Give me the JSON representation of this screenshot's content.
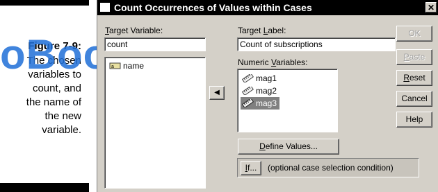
{
  "caption": {
    "figure_label": "Figure 7-9:",
    "lines": [
      "The chosen",
      "variables to",
      "count, and",
      "the name of",
      "the new",
      "variable."
    ]
  },
  "watermark": "oBooks",
  "dialog": {
    "title": "Count Occurrences of Values within Cases",
    "close_glyph": "✕",
    "target_variable": {
      "label_u": "T",
      "label_rest": "arget Variable:",
      "value": "count"
    },
    "target_label": {
      "label_pre": "Target ",
      "label_u": "L",
      "label_rest": "abel:",
      "value": "Count of subscriptions"
    },
    "source_list": [
      {
        "name": "name"
      }
    ],
    "numeric_variables": {
      "label_pre": "Numeric ",
      "label_u": "V",
      "label_rest": "ariables:",
      "items": [
        {
          "name": "mag1",
          "selected": false
        },
        {
          "name": "mag2",
          "selected": false
        },
        {
          "name": "mag3",
          "selected": true
        }
      ]
    },
    "move_arrow_glyph": "◀",
    "define_values": {
      "u": "D",
      "rest": "efine Values..."
    },
    "if_button": {
      "u": "I",
      "rest": "f..."
    },
    "if_condition_text": "(optional case selection condition)",
    "buttons": {
      "ok": "OK",
      "paste_u": "P",
      "paste_rest": "aste",
      "reset_u": "R",
      "reset_rest": "eset",
      "cancel": "Cancel",
      "help": "Help"
    }
  }
}
